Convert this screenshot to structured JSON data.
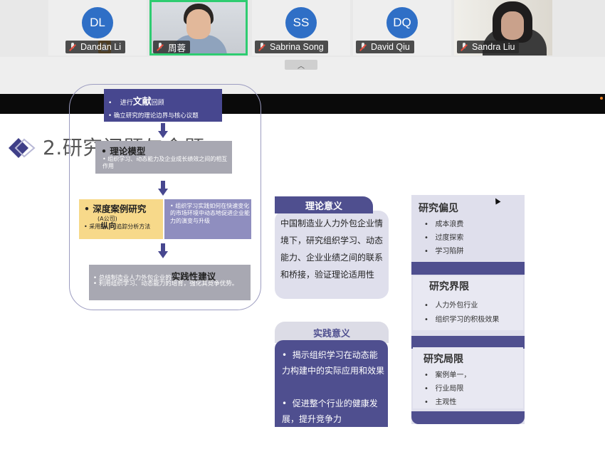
{
  "participants": [
    {
      "initials": "DL",
      "name": "Dandan Li",
      "type": "avatar",
      "host": true
    },
    {
      "initials": "",
      "name": "周蓉",
      "type": "video",
      "active": true
    },
    {
      "initials": "SS",
      "name": "Sabrina Song",
      "type": "avatar"
    },
    {
      "initials": "DQ",
      "name": "David Qiu",
      "type": "avatar"
    },
    {
      "initials": "",
      "name": "Sandra Liu",
      "type": "video"
    }
  ],
  "colors": {
    "avatar_bg": "#2f6fc6",
    "active_border": "#2ecc71",
    "slide_dark": "#4f4f8f",
    "slide_light": "#dfdfec",
    "accent_yellow": "#f7d98a"
  },
  "strip": {
    "collapse_icon": "chevron-up-icon",
    "collapse_glyph": "︿"
  },
  "slide": {
    "title": "2.研究问题与命题",
    "flow": {
      "box1_prefix": "进行",
      "box1_strong": "文献",
      "box1_suffix": "回顾",
      "box1_line2": "确立研究的理论边界与核心议题",
      "box2_title": "理论模型",
      "box2_desc": "组织学习、动态能力及企业成长绩效之间的相互作用",
      "box3_title": "深度案例研究",
      "box3_sub": "(A公司)",
      "box3_prefix": "采用",
      "box3_strong": "纵向",
      "box3_suffix": "追踪分析方法",
      "box4_desc": "组织学习实践如何在快速变化的市场环境中动态地促进企业能力的演变与升级",
      "box5_prefix": "总结制造业人力外包企业的",
      "box5_strong": "实践性建议",
      "box5_line2": "利用组织学习、动态能力的培育，强化其竞争优势。"
    },
    "theory": {
      "header": "理论意义",
      "body": "中国制造业人力外包企业情境下，研究组织学习、动态能力、企业业绩之间的联系和桥接，验证理论适用性"
    },
    "practice": {
      "header": "实践意义",
      "items": [
        "揭示组织学习在动态能力构建中的实际应用和效果",
        "促进整个行业的健康发展，提升竞争力"
      ]
    },
    "bias": {
      "header": "研究偏见",
      "items": [
        "成本浪费",
        "过度探索",
        "学习陷阱"
      ]
    },
    "boundary": {
      "header": "研究界限",
      "items": [
        "人力外包行业",
        "组织学习的积极效果"
      ]
    },
    "limits": {
      "header": "研究局限",
      "items": [
        "案例单一，",
        "行业局限",
        "主观性"
      ]
    }
  }
}
